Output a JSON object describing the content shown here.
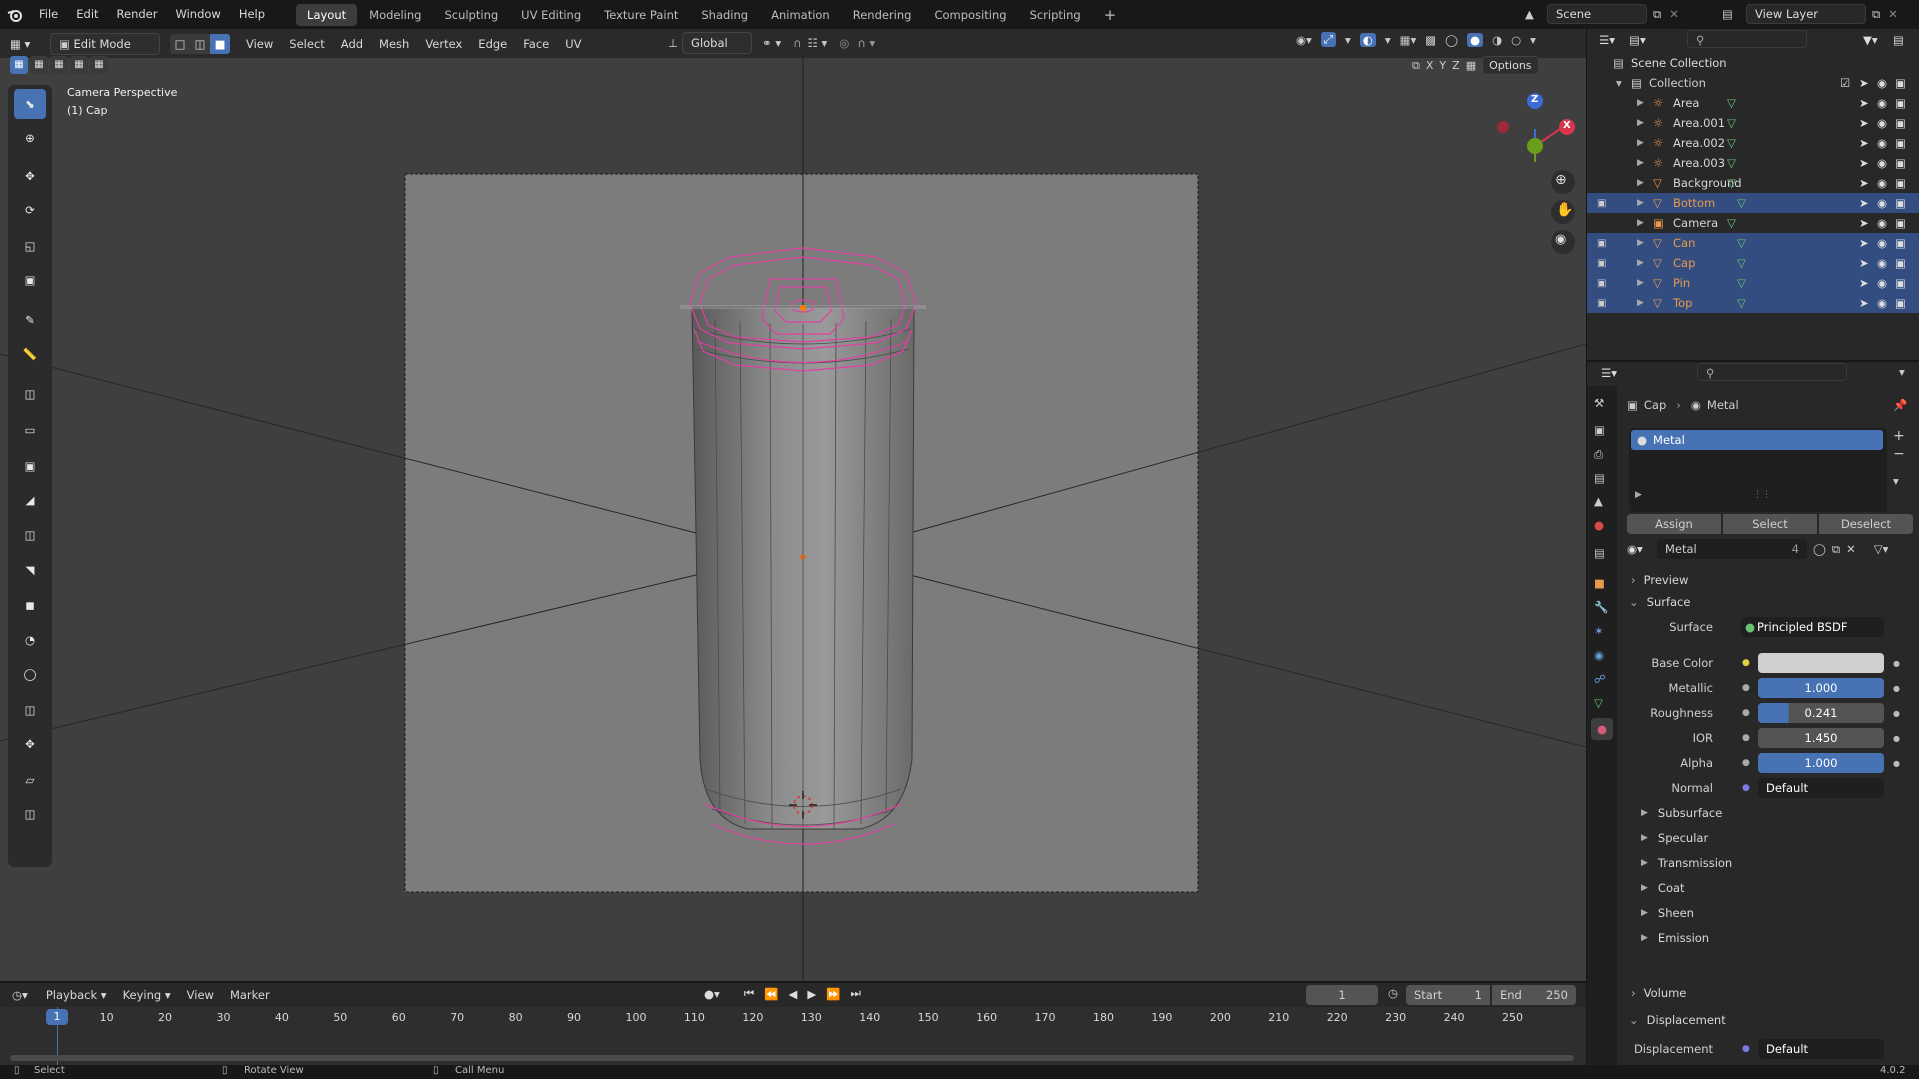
{
  "topbar": {
    "menus": [
      "File",
      "Edit",
      "Render",
      "Window",
      "Help"
    ],
    "workspaces": [
      "Layout",
      "Modeling",
      "Sculpting",
      "UV Editing",
      "Texture Paint",
      "Shading",
      "Animation",
      "Rendering",
      "Compositing",
      "Scripting"
    ],
    "active_workspace": "Layout",
    "add_tab": "+",
    "scene": "Scene",
    "view_layer": "View Layer"
  },
  "viewport": {
    "mode": "Edit Mode",
    "menus": [
      "View",
      "Select",
      "Add",
      "Mesh",
      "Vertex",
      "Edge",
      "Face",
      "UV"
    ],
    "transform_orientation": "Global",
    "axis_x": "X",
    "axis_y": "Y",
    "axis_z": "Z",
    "options": "Options",
    "overlay_title": "Camera Perspective",
    "overlay_object": "(1) Cap",
    "gizmo_z": "Z",
    "gizmo_x": "X"
  },
  "outliner": {
    "root": "Scene Collection",
    "collection": "Collection",
    "items": [
      {
        "name": "Area",
        "type": "light",
        "selected": false,
        "orange": false
      },
      {
        "name": "Area.001",
        "type": "light",
        "selected": false,
        "orange": false
      },
      {
        "name": "Area.002",
        "type": "light",
        "selected": false,
        "orange": false
      },
      {
        "name": "Area.003",
        "type": "light",
        "selected": false,
        "orange": false
      },
      {
        "name": "Background",
        "type": "mesh",
        "selected": false,
        "orange": false
      },
      {
        "name": "Bottom",
        "type": "mesh",
        "selected": true,
        "orange": true
      },
      {
        "name": "Camera",
        "type": "camera",
        "selected": false,
        "orange": false
      },
      {
        "name": "Can",
        "type": "mesh",
        "selected": true,
        "orange": true
      },
      {
        "name": "Cap",
        "type": "mesh",
        "selected": true,
        "orange": true
      },
      {
        "name": "Pin",
        "type": "mesh",
        "selected": true,
        "orange": true
      },
      {
        "name": "Top",
        "type": "mesh",
        "selected": true,
        "orange": true
      }
    ]
  },
  "properties": {
    "breadcrumb_object": "Cap",
    "breadcrumb_material": "Metal",
    "slot_name": "Metal",
    "assign": "Assign",
    "select": "Select",
    "deselect": "Deselect",
    "material_name": "Metal",
    "user_count": "4",
    "preview": "Preview",
    "surface_panel": "Surface",
    "surface_label": "Surface",
    "surface_value": "Principled BSDF",
    "base_color_label": "Base Color",
    "base_color": "#cfcfcf",
    "metallic_label": "Metallic",
    "metallic": "1.000",
    "metallic_fraction": 1.0,
    "roughness_label": "Roughness",
    "roughness": "0.241",
    "roughness_fraction": 0.241,
    "ior_label": "IOR",
    "ior": "1.450",
    "alpha_label": "Alpha",
    "alpha": "1.000",
    "alpha_fraction": 1.0,
    "normal_label": "Normal",
    "normal": "Default",
    "subpanels": [
      "Subsurface",
      "Specular",
      "Transmission",
      "Coat",
      "Sheen",
      "Emission"
    ],
    "volume": "Volume",
    "displacement_panel": "Displacement",
    "displacement_label": "Displacement",
    "displacement": "Default"
  },
  "timeline": {
    "menus": [
      "Playback",
      "Keying",
      "View",
      "Marker"
    ],
    "current_frame": "1",
    "start_label": "Start",
    "start": "1",
    "end_label": "End",
    "end": "250",
    "ticks": [
      "1",
      "10",
      "20",
      "30",
      "40",
      "50",
      "60",
      "70",
      "80",
      "90",
      "100",
      "110",
      "120",
      "130",
      "140",
      "150",
      "160",
      "170",
      "180",
      "190",
      "200",
      "210",
      "220",
      "230",
      "240",
      "250"
    ]
  },
  "statusbar": {
    "select": "Select",
    "rotate": "Rotate View",
    "call_menu": "Call Menu",
    "version": "4.0.2"
  },
  "colors": {
    "accent": "#4772b3",
    "selection_row": "#334d80",
    "edit_wire": "#e040a0",
    "object_orange": "#e89a4a"
  }
}
